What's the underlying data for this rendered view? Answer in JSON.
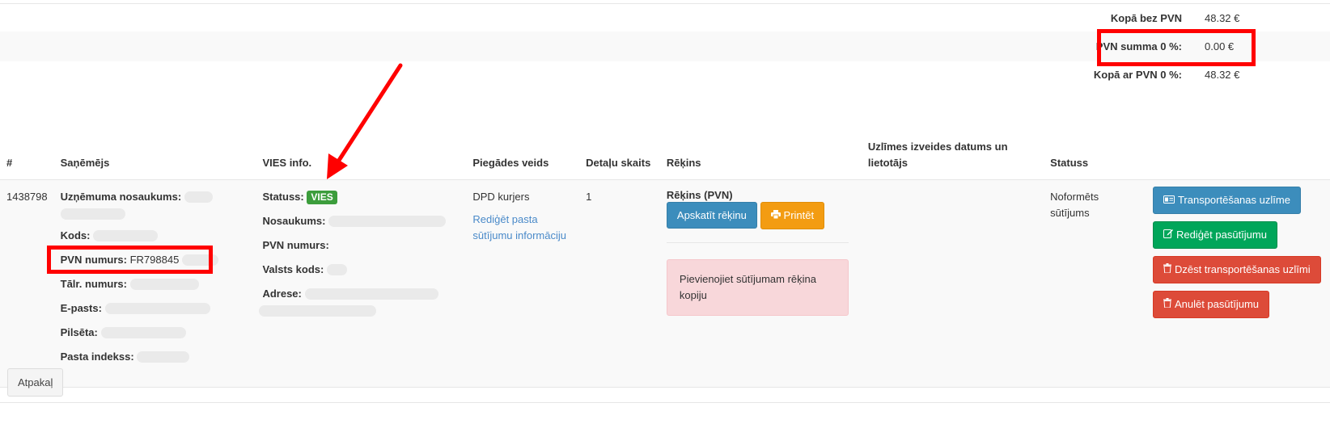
{
  "summary": {
    "net_label": "Kopā bez PVN",
    "net_value": "48.32 €",
    "vat_label": "PVN summa 0 %:",
    "vat_value": "0.00 €",
    "gross_label": "Kopā ar PVN 0 %:",
    "gross_value": "48.32 €"
  },
  "table": {
    "headers": {
      "id": "#",
      "recipient": "Saņēmējs",
      "vies": "VIES info.",
      "delivery": "Piegādes veids",
      "parts": "Detaļu skaits",
      "invoice": "Rēķins",
      "label_date": "Uzlīmes izveides datums un lietotājs",
      "status": "Statuss"
    },
    "row": {
      "id": "1438798",
      "recipient": {
        "company_label": "Uzņēmuma nosaukums:",
        "code_label": "Kods:",
        "vat_label": "PVN numurs:",
        "vat_value": "FR798845",
        "phone_label": "Tālr. numurs:",
        "email_label": "E-pasts:",
        "city_label": "Pilsēta:",
        "postal_label": "Pasta indekss:"
      },
      "vies": {
        "status_label": "Statuss:",
        "status_badge": "VIES",
        "name_label": "Nosaukums:",
        "vat_label": "PVN numurs:",
        "country_label": "Valsts kods:",
        "address_label": "Adrese:"
      },
      "delivery": {
        "method": "DPD kurjers",
        "edit_link": "Rediģēt pasta sūtījumu informāciju"
      },
      "parts_count": "1",
      "invoice": {
        "title": "Rēķins (PVN)",
        "view_button": "Apskatīt rēķinu",
        "print_button": "Printēt",
        "alert": "Pievienojiet sūtījumam rēķina kopiju"
      },
      "status": "Noformēts sūtījums",
      "actions": {
        "transport_label": "Transportēšanas uzlīme",
        "edit_order": "Rediģēt pasūtījumu",
        "delete_label": "Dzēst transportēšanas uzlīmi",
        "cancel_order": "Anulēt pasūtījumu"
      }
    }
  },
  "footer": {
    "back_button": "Atpakaļ"
  },
  "colors": {
    "highlight": "#ff0000",
    "primary": "#3c8dbc",
    "warning": "#f39c12",
    "success": "#00a65a",
    "danger": "#dd4b39",
    "badge": "#3c9d3c",
    "link": "#4a8ac9"
  }
}
